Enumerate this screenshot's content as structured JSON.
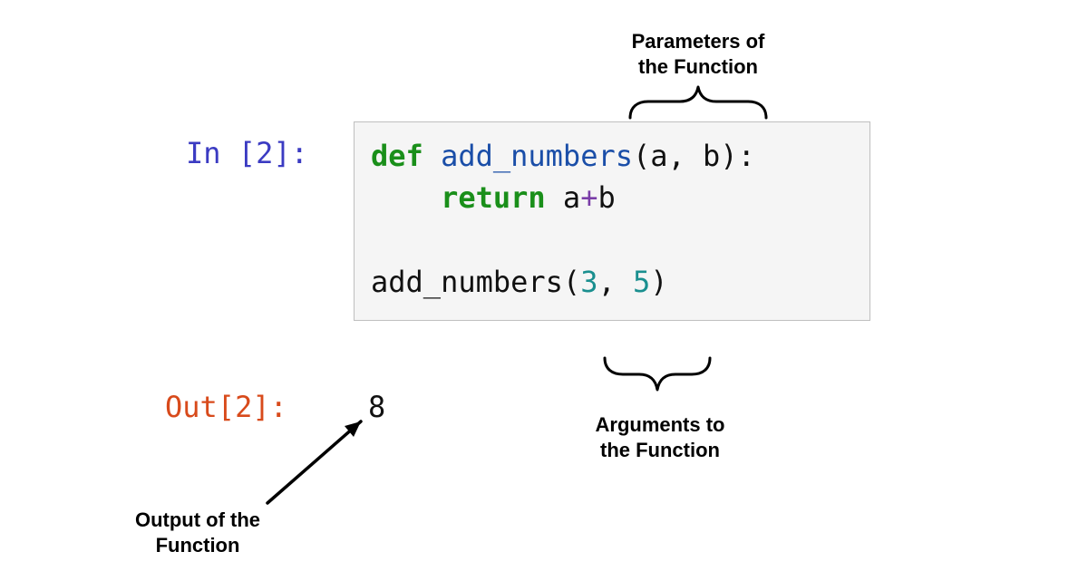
{
  "prompts": {
    "in_label": "In [2]:",
    "out_label": "Out[2]:"
  },
  "code": {
    "kw_def": "def",
    "func_name": "add_numbers",
    "open_paren": "(",
    "param_a": "a",
    "sep1": ", ",
    "param_b": "b",
    "close_paren_colon": "):",
    "kw_return": "return",
    "ret_space": " ",
    "ret_a": "a",
    "plus": "+",
    "ret_b": "b",
    "call_name": "add_numbers",
    "call_open": "(",
    "arg1": "3",
    "call_sep": ", ",
    "arg2": "5",
    "call_close": ")"
  },
  "output": {
    "value": "8"
  },
  "annotations": {
    "parameters_line1": "Parameters of",
    "parameters_line2": "the Function",
    "arguments_line1": "Arguments to",
    "arguments_line2": "the Function",
    "output_line1": "Output of the",
    "output_line2": "Function"
  }
}
